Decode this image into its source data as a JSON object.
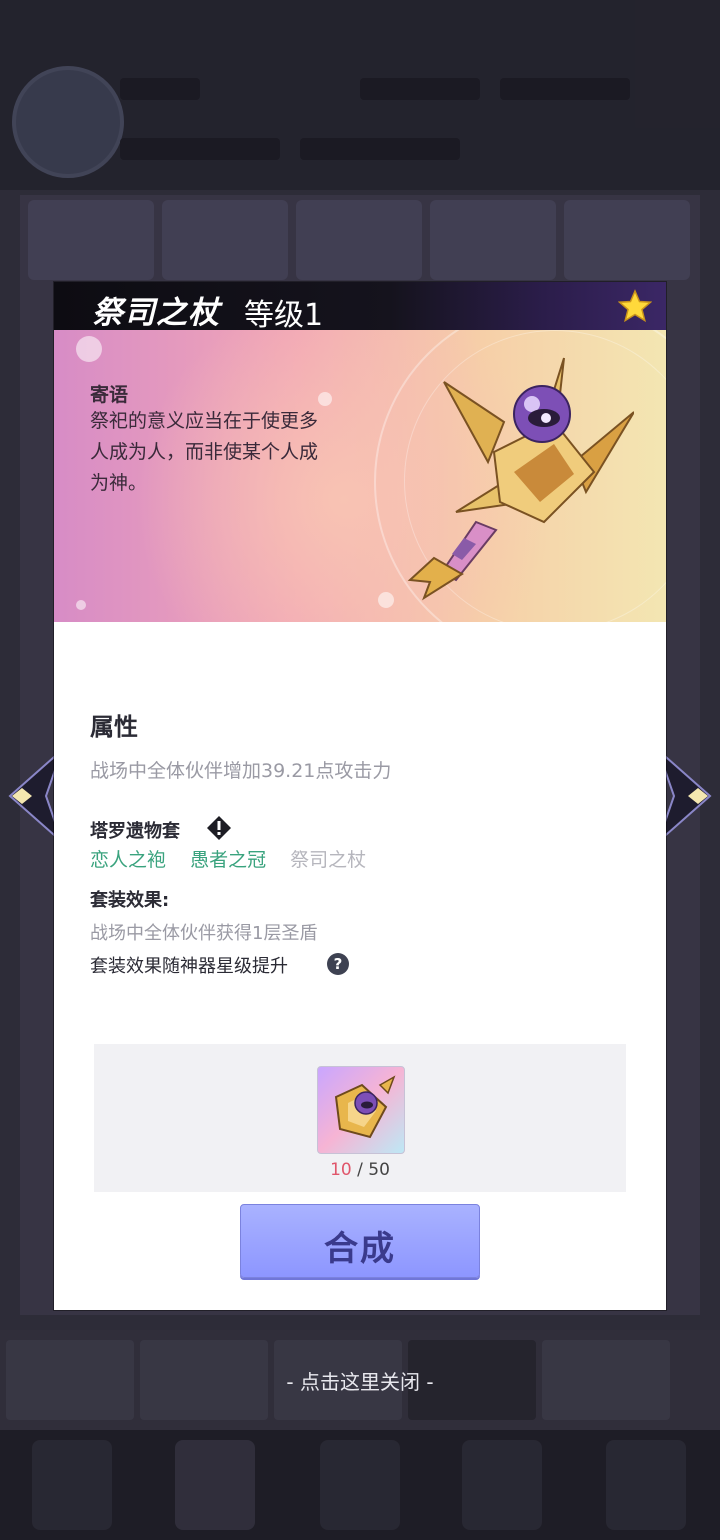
{
  "item": {
    "name": "祭司之杖",
    "level": "等级1"
  },
  "banner": {
    "quote_title": "寄语",
    "quote_text": "祭祀的意义应当在于使更多人成为人，而非使某个人成为神。"
  },
  "attributes": {
    "title": "属性",
    "description": "战场中全体伙伴增加39.21点攻击力"
  },
  "set": {
    "name": "塔罗遗物套",
    "items": [
      {
        "label": "恋人之袍",
        "owned": true
      },
      {
        "label": "愚者之冠",
        "owned": true
      },
      {
        "label": "祭司之杖",
        "owned": false
      }
    ],
    "effect_title": "套装效果:",
    "effect_description": "战场中全体伙伴获得1层圣盾",
    "effect_note": "套装效果随神器星级提升"
  },
  "material": {
    "have": "10",
    "separator": " / ",
    "need": "50"
  },
  "craft_button": {
    "label": "合成"
  },
  "close_hint": "- 点击这里关闭 -",
  "icons": {
    "star": "star-icon",
    "info": "info-icon",
    "help": "help-icon",
    "prev": "arrow-left-icon",
    "next": "arrow-right-icon"
  },
  "colors": {
    "set_owned": "#3aa37e",
    "set_missing": "#b6b6bd",
    "button": "#8d96ff",
    "count_have": "#e0566b"
  }
}
